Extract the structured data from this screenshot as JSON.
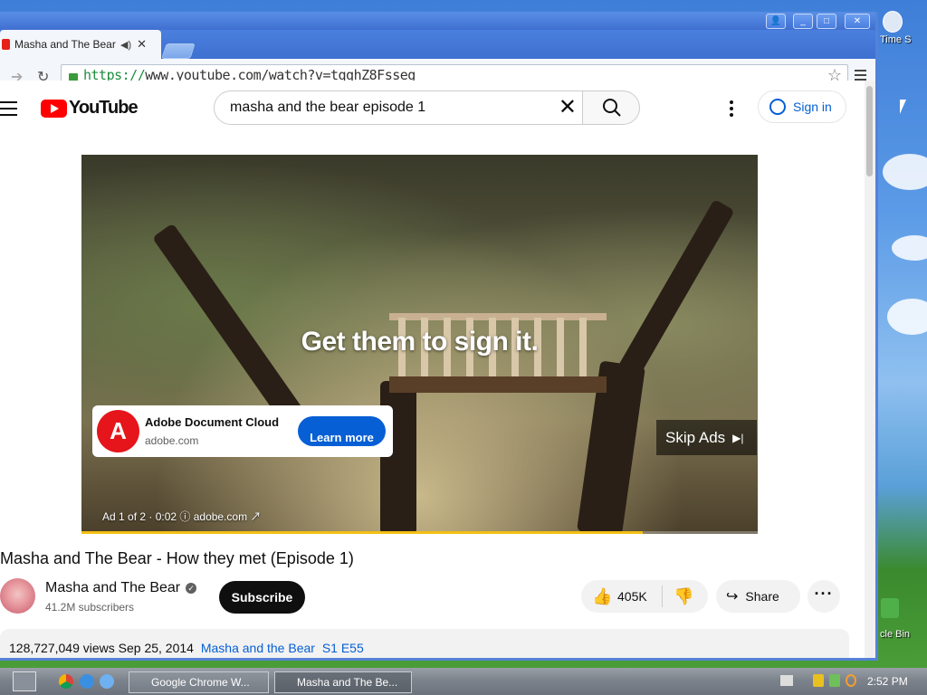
{
  "browser": {
    "tab_title": "Masha and The Bear -",
    "url_scheme": "https://",
    "url_rest": "www.youtube.com/watch?v=tqqhZ8Fsseg"
  },
  "youtube": {
    "logo_text": "YouTube",
    "search_value": "masha and the bear episode 1",
    "sign_in": "Sign in"
  },
  "ad": {
    "headline": "Get them to sign it.",
    "advertiser": "Adobe Document Cloud",
    "domain": "adobe.com",
    "cta": "Learn more",
    "skip": "Skip Ads",
    "info": "Ad 1 of 2 · 0:02  ⓘ   adobe.com ↗",
    "progress": 0.83
  },
  "video": {
    "title": "Masha and The Bear - How they met (Episode 1)",
    "channel": "Masha and The Bear",
    "subscribers": "41.2M subscribers",
    "subscribe": "Subscribe",
    "likes": "405K",
    "share": "Share",
    "views": "128,727,049 views",
    "date": "Sep 25, 2014",
    "tag1": "Masha and the Bear",
    "tag2": "S1 E55"
  },
  "desktop": {
    "label_top": "Time S",
    "label_bin": "cle Bin"
  },
  "taskbar": {
    "task1": "Google Chrome W...",
    "task2": "Masha and The Be...",
    "clock": "2:52 PM"
  }
}
